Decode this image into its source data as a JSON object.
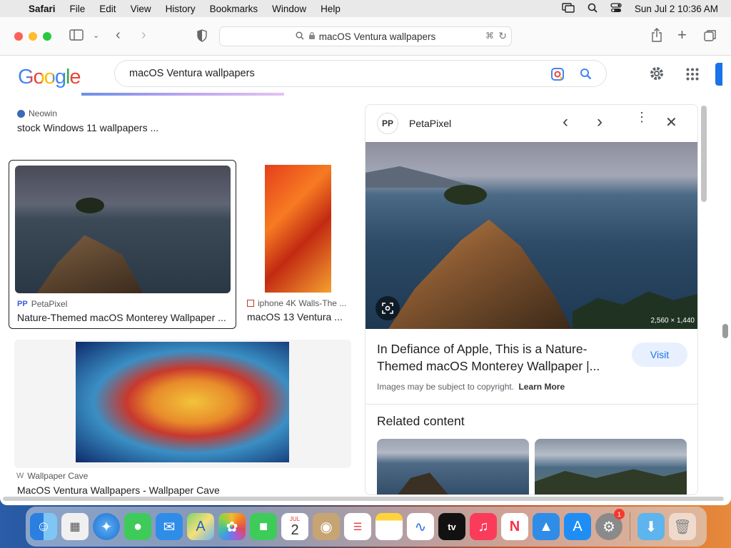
{
  "menubar": {
    "app": "Safari",
    "items": [
      "File",
      "Edit",
      "View",
      "History",
      "Bookmarks",
      "Window",
      "Help"
    ],
    "clock": "Sun Jul 2  10:36 AM"
  },
  "browser": {
    "url": "macOS Ventura wallpapers"
  },
  "google": {
    "logo": "Google",
    "query": "macOS Ventura wallpapers"
  },
  "results": [
    {
      "source": "Neowin",
      "title": "stock Windows 11 wallpapers ..."
    },
    {
      "source": "PetaPixel",
      "title": "Nature-Themed macOS Monterey Wallpaper ..."
    },
    {
      "source": "iphone 4K Walls-The ...",
      "title": "macOS 13 Ventura ..."
    },
    {
      "source": "Wallpaper Cave",
      "title": "MacOS Ventura Wallpapers - Wallpaper Cave"
    }
  ],
  "panel": {
    "source": "PetaPixel",
    "dimensions": "2,560 × 1,440",
    "title": "In Defiance of Apple, This is a Nature-Themed macOS Monterey Wallpaper |...",
    "visit": "Visit",
    "copyright": "Images may be subject to copyright.",
    "learn_more": "Learn More",
    "related": "Related content"
  },
  "dock": {
    "calendar_month": "JUL",
    "calendar_day": "2",
    "settings_badge": "1",
    "tv_label": "tv"
  }
}
